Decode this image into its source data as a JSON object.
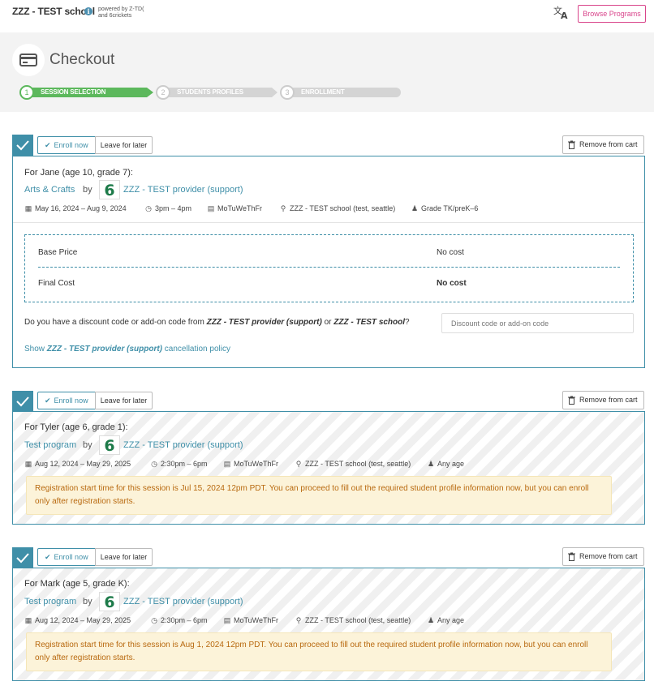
{
  "topbar": {
    "school_name": "ZZZ - TEST school",
    "info_icon": "info-icon",
    "powered_line1": "powered by Z-TD(",
    "powered_line2": "and 6crickets",
    "browse_label": "Browse Programs"
  },
  "header": {
    "title": "Checkout",
    "steps": [
      {
        "number": "1",
        "label": "SESSION SELECTION"
      },
      {
        "number": "2",
        "label": "STUDENTS PROFILES"
      },
      {
        "number": "3",
        "label": "ENROLLMENT"
      }
    ]
  },
  "actions": {
    "enroll_now": "Enroll now",
    "leave_for_later": "Leave for later",
    "remove_from_cart": "Remove from cart"
  },
  "by_label": "by",
  "logo_glyph": "6",
  "sessions": [
    {
      "for_prefix": "For ",
      "student": "Jane",
      "student_detail": " (age 10, grade 7):",
      "program": "Arts & Crafts",
      "provider": "ZZZ - TEST provider (support)",
      "dates": "May 16, 2024 – Aug 9, 2024",
      "time": "3pm – 4pm",
      "days": "MoTuWeThFr",
      "location": "ZZZ - TEST school (test, seattle)",
      "grade": "Grade TK/preK–6",
      "base_price_label": "Base Price",
      "base_price_value": "No cost",
      "final_cost_label": "Final Cost",
      "final_cost_value": "No cost",
      "discount_q_prefix": "Do you have a discount code or add-on code from ",
      "discount_q_provider": "ZZZ - TEST provider (support)",
      "discount_q_or": " or ",
      "discount_q_school": "ZZZ - TEST school",
      "discount_q_suffix": "?",
      "discount_placeholder": "Discount code or add-on code",
      "cancel_prefix": "Show ",
      "cancel_provider": "ZZZ - TEST provider (support)",
      "cancel_suffix": " cancellation policy"
    },
    {
      "for_prefix": "For ",
      "student": "Tyler",
      "student_detail": " (age 6, grade 1):",
      "program": "Test program",
      "provider": "ZZZ - TEST provider (support)",
      "dates": "Aug 12, 2024 – May 29, 2025",
      "time": "2:30pm – 6pm",
      "days": "MoTuWeThFr",
      "location": "ZZZ - TEST school (test, seattle)",
      "grade": "Any age",
      "notice": "Registration start time for this session is Jul 15, 2024 12pm PDT. You can proceed to fill out the required student profile information now, but you can enroll only after registration starts."
    },
    {
      "for_prefix": "For ",
      "student": "Mark",
      "student_detail": " (age 5, grade K):",
      "program": "Test program",
      "provider": "ZZZ - TEST provider (support)",
      "dates": "Aug 12, 2024 – May 29, 2025",
      "time": "2:30pm – 6pm",
      "days": "MoTuWeThFr",
      "location": "ZZZ - TEST school (test, seattle)",
      "grade": "Any age",
      "notice": "Registration start time for this session is Aug 1, 2024 12pm PDT. You can proceed to fill out the required student profile information now, but you can enroll only after registration starts."
    }
  ],
  "colors": {
    "teal": "#3f8fa8",
    "green": "#5cb85c",
    "pink": "#d9458b",
    "notice_bg": "#fcf3d9",
    "notice_text": "#b8690f"
  }
}
